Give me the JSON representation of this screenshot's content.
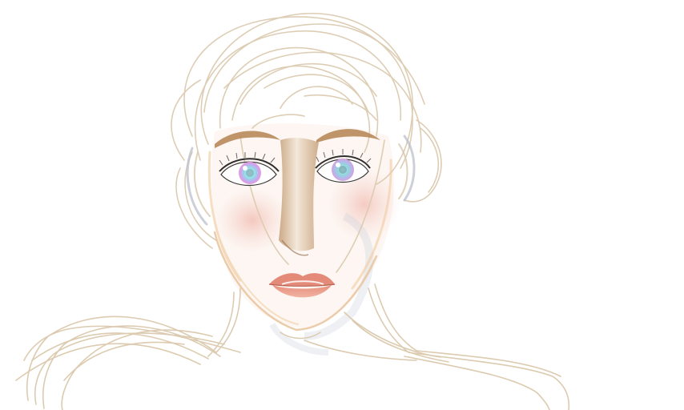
{
  "artwork": {
    "subject_icon": "portrait-sketch-icon",
    "colors": {
      "background": "#ffffff",
      "sketch_line": "#d9c8ad",
      "skin_blush": "#f3c9c1",
      "brow_and_nose": "#b8895a",
      "iris_cyan": "#8fe0e6",
      "iris_pink": "#e59ad8",
      "lips": "#e79a86",
      "shadow_grey": "#b9b9c4",
      "lash_line": "#3a3a3a"
    }
  }
}
